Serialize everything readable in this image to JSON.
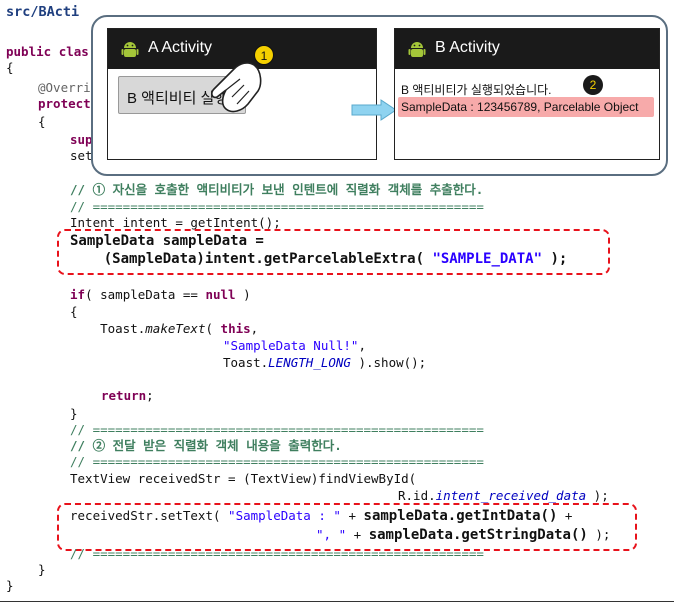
{
  "code": {
    "header": "src/BActi",
    "class_kw": "public",
    "class_frag": "clas",
    "brace_open": "{",
    "override_frag": "@Overri",
    "protected_kw": "protect",
    "inner_brace": "{",
    "sup_frag": "sup",
    "set_frag": "set",
    "comment1": "// ① 자신을 호출한 액티비티가 보낸 인텐트에 직렬화 객체를 추출한다.",
    "rule1": "// ====================================================",
    "intent_line": "Intent intent = getIntent();",
    "sample_line1": "SampleData sampleData =",
    "sample_line2a": "    (SampleData)intent.getParcelableExtra( ",
    "sample_string": "\"SAMPLE_DATA\"",
    "sample_line2c": " );",
    "if_kw": "if",
    "if_mid": "( sampleData == ",
    "null_kw": "null",
    "if_end": " )",
    "if_brace": "{",
    "toast_pre": "    Toast.",
    "toast_method": "makeText",
    "toast_mid": "( ",
    "this_kw": "this",
    "toast_comma": ",",
    "toast_string": "\"SampleData Null!\"",
    "toast_string_comma": ",",
    "toast_len_pre": "Toast.",
    "toast_len": "LENGTH_LONG",
    "toast_end": " ).show();",
    "return_kw": "return",
    "return_end": ";",
    "if_close": "}",
    "rule2": "// ====================================================",
    "comment2": "// ② 전달 받은 직렬화 객체 내용을 출력한다.",
    "rule3": "// ====================================================",
    "textview_line": "TextView receivedStr = (TextView)findViewById(",
    "rid_pre": "R.id.",
    "rid_field": "intent_received_data",
    "rid_end": " );",
    "recv_pre": "receivedStr.setText( ",
    "recv_str1": "\"SampleData : \"",
    "recv_plus": " + ",
    "recv_getint": "sampleData.getIntData()",
    "recv_plus_end": " +",
    "recv_str2": "\", \"",
    "recv_plus2": " + ",
    "recv_getstr": "sampleData.getStringData()",
    "recv_end": " );",
    "rule4": "// ====================================================",
    "method_close": "}",
    "class_close": "}"
  },
  "overlay": {
    "activity_a": {
      "title": "A Activity",
      "button_label": "B 액티비티 실행",
      "badge": "1"
    },
    "activity_b": {
      "title": "B Activity",
      "message": "B 액티비티가 실행되었습니다.",
      "data_line": "SampleData : 123456789, Parcelable Object",
      "badge": "2"
    }
  },
  "colors": {
    "keyword": "#7f0055",
    "comment": "#3f7f5f",
    "string": "#2a00ff",
    "highlight_border": "#e8121b",
    "arrow": "#8fd3f0",
    "badge": "#f5d000"
  }
}
